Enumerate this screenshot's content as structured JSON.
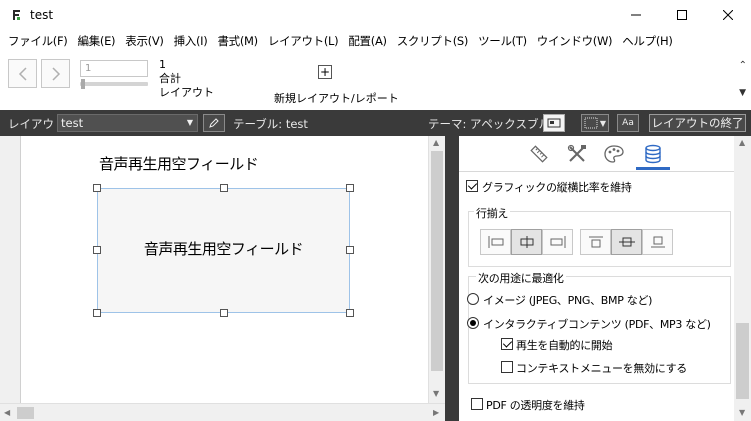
{
  "window": {
    "title": "test"
  },
  "menu": [
    {
      "label": "ファイル(F)"
    },
    {
      "label": "編集(E)"
    },
    {
      "label": "表示(V)"
    },
    {
      "label": "挿入(I)"
    },
    {
      "label": "書式(M)"
    },
    {
      "label": "レイアウト(L)"
    },
    {
      "label": "配置(A)"
    },
    {
      "label": "スクリプト(S)"
    },
    {
      "label": "ツール(T)"
    },
    {
      "label": "ウインドウ(W)"
    },
    {
      "label": "ヘルプ(H)"
    }
  ],
  "toolbar": {
    "record_input_value": "1",
    "record_count": "1",
    "total_label": "合計",
    "layout_label": "レイアウト",
    "new_layout_label": "新規レイアウト/レポート"
  },
  "layoutbar": {
    "layout_label": "レイアウト:",
    "layout_value": "test",
    "table_label": "テーブル: test",
    "theme_label": "テーマ: アペックスブルー",
    "aa_label": "Aa",
    "exit_label": "レイアウトの終了"
  },
  "canvas": {
    "field_label": "音声再生用空フィールド",
    "field_box_text": "音声再生用空フィールド"
  },
  "inspector": {
    "tabs": [
      {
        "icon": "ruler-icon"
      },
      {
        "icon": "tools-icon"
      },
      {
        "icon": "palette-icon"
      },
      {
        "icon": "database-icon",
        "active": true
      }
    ],
    "keep_aspect_label": "グラフィックの縦横比率を維持",
    "keep_aspect_checked": true,
    "alignment_title": "行揃え",
    "optimize_title": "次の用途に最適化",
    "image_option_label": "イメージ (JPEG、PNG、BMP など)",
    "image_option_checked": false,
    "interactive_option_label": "インタラクティブコンテンツ (PDF、MP3 など)",
    "interactive_option_checked": true,
    "autoplay_label": "再生を自動的に開始",
    "autoplay_checked": true,
    "disable_context_label": "コンテキストメニューを無効にする",
    "disable_context_checked": false,
    "pdf_transparency_label": "PDF の透明度を維持",
    "pdf_transparency_checked": false
  }
}
